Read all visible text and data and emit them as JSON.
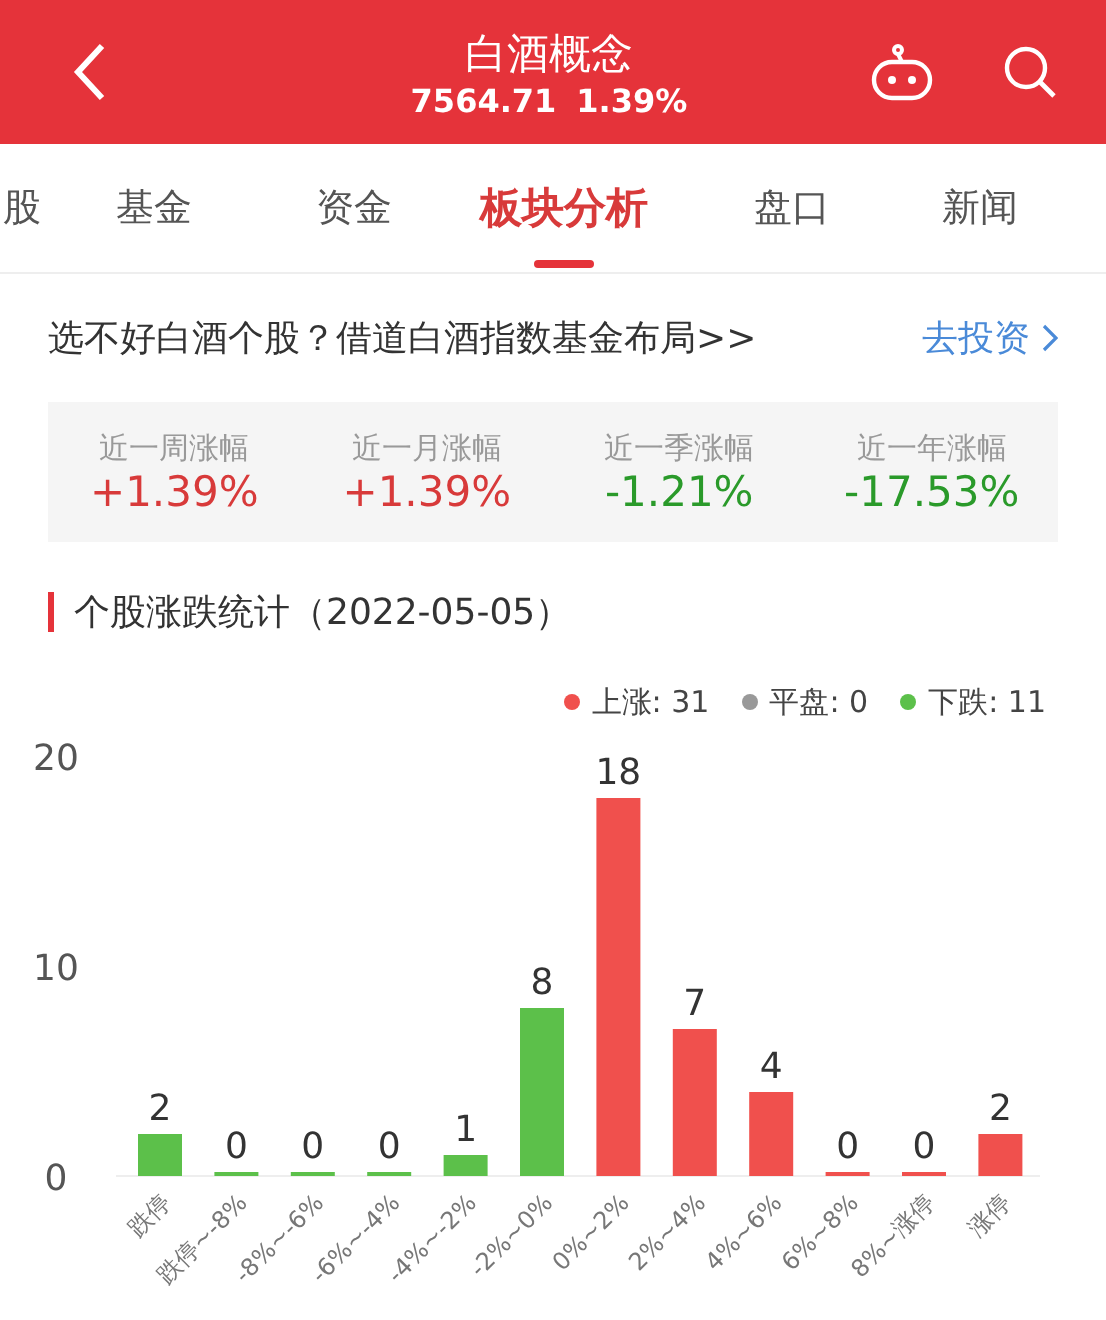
{
  "header": {
    "title": "白酒概念",
    "price": "7564.71",
    "change": "1.39%"
  },
  "tabs": [
    {
      "label": "股",
      "selected": false
    },
    {
      "label": "基金",
      "selected": false
    },
    {
      "label": "资金",
      "selected": false
    },
    {
      "label": "板块分析",
      "selected": true
    },
    {
      "label": "盘口",
      "selected": false
    },
    {
      "label": "新闻",
      "selected": false
    }
  ],
  "promo": {
    "text": "选不好白酒个股？借道白酒指数基金布局>>",
    "link": "去投资"
  },
  "stats": [
    {
      "label": "近一周涨幅",
      "value": "+1.39%",
      "color": "#d83a3a"
    },
    {
      "label": "近一月涨幅",
      "value": "+1.39%",
      "color": "#d83a3a"
    },
    {
      "label": "近一季涨幅",
      "value": "-1.21%",
      "color": "#2a9a2a"
    },
    {
      "label": "近一年涨幅",
      "value": "-17.53%",
      "color": "#2a9a2a"
    }
  ],
  "section_title": "个股涨跌统计（2022-05-05）",
  "legend": [
    {
      "label": "上涨: 31",
      "color": "#f0504d"
    },
    {
      "label": "平盘: 0",
      "color": "#999999"
    },
    {
      "label": "下跌: 11",
      "color": "#5cc04a"
    }
  ],
  "chart_data": {
    "type": "bar",
    "data_labels": true,
    "categories": [
      "跌停",
      "跌停~-8%",
      "-8%~-6%",
      "-6%~-4%",
      "-4%~-2%",
      "-2%~0%",
      "0%~2%",
      "2%~4%",
      "4%~6%",
      "6%~8%",
      "8%~涨停",
      "涨停"
    ],
    "ylim": [
      0,
      20
    ],
    "yticks": [
      0,
      10,
      20
    ],
    "series": [
      {
        "color": "#5cc04a",
        "values": [
          2,
          0,
          0,
          0,
          1,
          8,
          null,
          null,
          null,
          null,
          null,
          null
        ]
      },
      {
        "color": "#f0504d",
        "values": [
          null,
          null,
          null,
          null,
          null,
          null,
          18,
          7,
          4,
          0,
          0,
          2
        ]
      }
    ]
  }
}
